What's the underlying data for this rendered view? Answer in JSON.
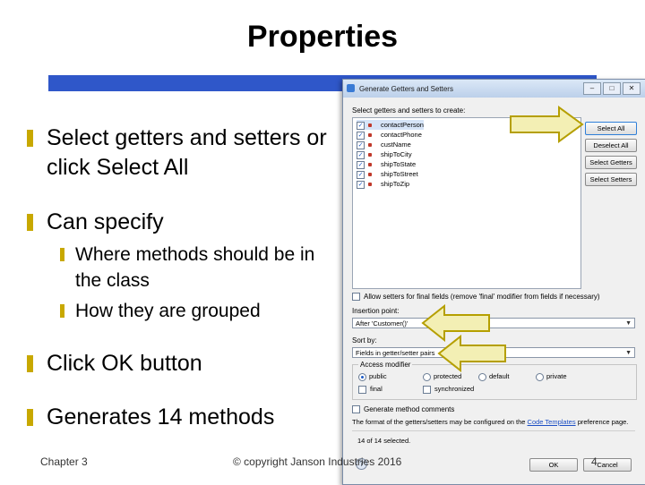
{
  "slide": {
    "title": "Properties",
    "bullets": [
      {
        "text": "Select getters and setters or click Select All"
      },
      {
        "text": "Can specify"
      },
      {
        "text": "Click OK button"
      },
      {
        "text": "Generates 14 methods"
      }
    ],
    "sub_bullets": [
      {
        "text": "Where methods should be in the class"
      },
      {
        "text": "How they are grouped"
      }
    ],
    "footer_left": "Chapter 3",
    "footer_center": "© copyright Janson Industries 2016",
    "page_number": "4"
  },
  "dialog": {
    "title": "Generate Getters and Setters",
    "select_label": "Select getters and setters to create:",
    "fields": [
      {
        "name": "contactPerson",
        "checked": true
      },
      {
        "name": "contactPhone",
        "checked": true
      },
      {
        "name": "custName",
        "checked": true
      },
      {
        "name": "shipToCity",
        "checked": true
      },
      {
        "name": "shipToState",
        "checked": true
      },
      {
        "name": "shipToStreet",
        "checked": true
      },
      {
        "name": "shipToZip",
        "checked": true
      }
    ],
    "buttons": {
      "select_all": "Select All",
      "deselect_all": "Deselect All",
      "select_getters": "Select Getters",
      "select_setters": "Select Setters",
      "ok": "OK",
      "cancel": "Cancel"
    },
    "allow_setters_label": "Allow setters for final fields (remove 'final' modifier from fields if necessary)",
    "insertion_label": "Insertion point:",
    "insertion_value": "After 'Customer()'",
    "sortby_label": "Sort by:",
    "sortby_value": "Fields in getter/setter pairs",
    "access_label": "Access modifier",
    "access_options": [
      "public",
      "protected",
      "default",
      "private"
    ],
    "access_selected": "public",
    "modifier_options": [
      "final",
      "synchronized"
    ],
    "comments_label": "Generate method comments",
    "format_text": "The format of the getters/setters may be configured on the",
    "format_link": "Code Templates",
    "format_suffix": "preference page.",
    "count_text": "14 of 14 selected.",
    "window_buttons": {
      "minimize": "–",
      "maximize": "□",
      "close": "✕"
    }
  },
  "colors": {
    "accent_bar": "#2f57c9",
    "bullet": "#c8a800",
    "arrow_fill": "#f3efb4",
    "arrow_stroke": "#b59f00"
  }
}
